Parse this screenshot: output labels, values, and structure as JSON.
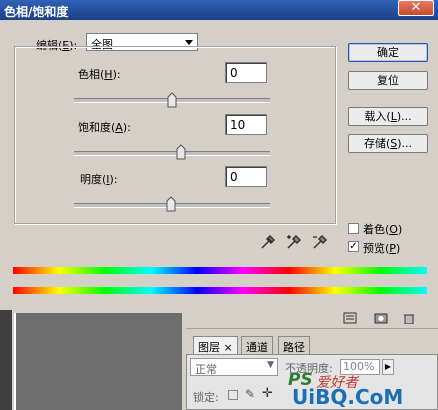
{
  "window": {
    "title": "色相/饱和度",
    "close_glyph": "✕"
  },
  "edit": {
    "label": "编辑",
    "accesskey": "E",
    "value": "全图"
  },
  "sliders": [
    {
      "label": "色相",
      "accesskey": "H",
      "value": "0",
      "level": 0.5
    },
    {
      "label": "饱和度",
      "accesskey": "A",
      "value": "10",
      "level": 0.55
    },
    {
      "label": "明度",
      "accesskey": "I",
      "value": "0",
      "level": 0.5
    }
  ],
  "buttons": {
    "ok": "确定",
    "reset": "复位",
    "load": "载入",
    "load_key": "L",
    "save": "存储",
    "save_key": "S"
  },
  "options": {
    "colorize": {
      "label": "着色",
      "key": "O",
      "checked": false
    },
    "preview": {
      "label": "预览",
      "key": "P",
      "checked": true
    }
  },
  "layers_panel": {
    "tabs": [
      "图层",
      "通道",
      "路径"
    ],
    "blend_mode": "正常",
    "opacity_label": "不透明度:",
    "opacity_value": "100%",
    "lock_label": "锁定:",
    "watermark": "UiBQ.CoM",
    "watermark_ps": "PS",
    "watermark_cn": "爱好者"
  },
  "colors": {
    "title_bar": "#1d3f86",
    "dialog_bg": "#d4d0c8",
    "canvas": "#6e6e6e"
  }
}
